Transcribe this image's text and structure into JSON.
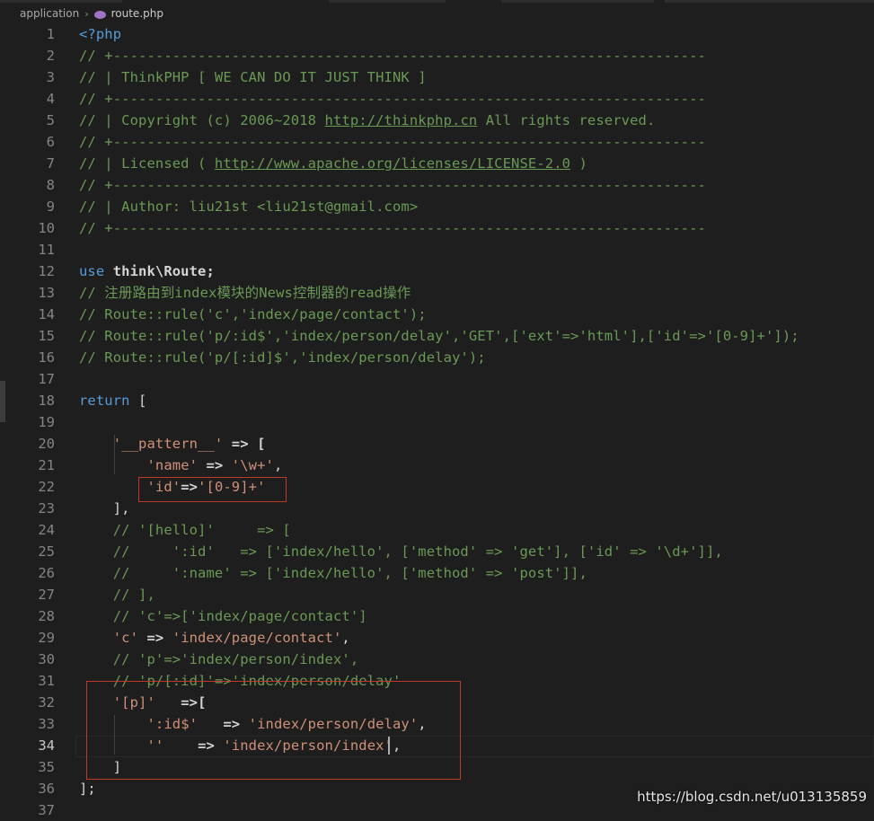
{
  "breadcrumb": {
    "folder": "application",
    "file": "route.php",
    "file_icon": "php-elephant-icon"
  },
  "editor": {
    "active_line": 34,
    "lines": [
      {
        "n": "1",
        "parts": [
          {
            "t": "<?php",
            "c": "kw"
          }
        ]
      },
      {
        "n": "2",
        "parts": [
          {
            "t": "// +----------------------------------------------------------------------",
            "c": "com"
          }
        ]
      },
      {
        "n": "3",
        "parts": [
          {
            "t": "// | ThinkPHP [ WE CAN DO IT JUST THINK ]",
            "c": "com"
          }
        ]
      },
      {
        "n": "4",
        "parts": [
          {
            "t": "// +----------------------------------------------------------------------",
            "c": "com"
          }
        ]
      },
      {
        "n": "5",
        "parts": [
          {
            "t": "// | Copyright (c) 2006~2018 ",
            "c": "com"
          },
          {
            "t": "http://thinkphp.cn",
            "c": "com link"
          },
          {
            "t": " All rights reserved.",
            "c": "com"
          }
        ]
      },
      {
        "n": "6",
        "parts": [
          {
            "t": "// +----------------------------------------------------------------------",
            "c": "com"
          }
        ]
      },
      {
        "n": "7",
        "parts": [
          {
            "t": "// | Licensed ( ",
            "c": "com"
          },
          {
            "t": "http://www.apache.org/licenses/LICENSE-2.0",
            "c": "com link"
          },
          {
            "t": " )",
            "c": "com"
          }
        ]
      },
      {
        "n": "8",
        "parts": [
          {
            "t": "// +----------------------------------------------------------------------",
            "c": "com"
          }
        ]
      },
      {
        "n": "9",
        "parts": [
          {
            "t": "// | Author: liu21st <liu21st@gmail.com>",
            "c": "com"
          }
        ]
      },
      {
        "n": "10",
        "parts": [
          {
            "t": "// +----------------------------------------------------------------------",
            "c": "com"
          }
        ]
      },
      {
        "n": "11",
        "parts": []
      },
      {
        "n": "12",
        "parts": [
          {
            "t": "use",
            "c": "kw"
          },
          {
            "t": " think\\Route;",
            "c": "bold"
          }
        ]
      },
      {
        "n": "13",
        "parts": [
          {
            "t": "// 注册路由到index模块的News控制器的read操作",
            "c": "com"
          }
        ]
      },
      {
        "n": "14",
        "parts": [
          {
            "t": "// Route::rule('c','index/page/contact');",
            "c": "com"
          }
        ]
      },
      {
        "n": "15",
        "parts": [
          {
            "t": "// Route::rule('p/:id$','index/person/delay','GET',['ext'=>'html'],['id'=>'[0-9]+']);",
            "c": "com"
          }
        ]
      },
      {
        "n": "16",
        "parts": [
          {
            "t": "// Route::rule('p/[:id]$','index/person/delay');",
            "c": "com"
          }
        ]
      },
      {
        "n": "17",
        "parts": []
      },
      {
        "n": "18",
        "parts": [
          {
            "t": "return",
            "c": "kw"
          },
          {
            "t": " [",
            "c": "plain"
          }
        ]
      },
      {
        "n": "19",
        "parts": []
      },
      {
        "n": "20",
        "parts": [
          {
            "t": "    ",
            "c": "plain"
          },
          {
            "t": "'__pattern__'",
            "c": "str"
          },
          {
            "t": " => [",
            "c": "bold"
          }
        ]
      },
      {
        "n": "21",
        "parts": [
          {
            "t": "        ",
            "c": "plain"
          },
          {
            "t": "'name'",
            "c": "str"
          },
          {
            "t": " => ",
            "c": "bold"
          },
          {
            "t": "'\\w+'",
            "c": "str"
          },
          {
            "t": ",",
            "c": "plain"
          }
        ]
      },
      {
        "n": "22",
        "parts": [
          {
            "t": "        ",
            "c": "plain"
          },
          {
            "t": "'id'",
            "c": "str"
          },
          {
            "t": "=>",
            "c": "bold"
          },
          {
            "t": "'[0-9]+'",
            "c": "str"
          }
        ]
      },
      {
        "n": "23",
        "parts": [
          {
            "t": "    ],",
            "c": "plain"
          }
        ]
      },
      {
        "n": "24",
        "parts": [
          {
            "t": "    // '[hello]'     => [",
            "c": "com"
          }
        ]
      },
      {
        "n": "25",
        "parts": [
          {
            "t": "    //     ':id'   => ['index/hello', ['method' => 'get'], ['id' => '\\d+']],",
            "c": "com"
          }
        ]
      },
      {
        "n": "26",
        "parts": [
          {
            "t": "    //     ':name' => ['index/hello', ['method' => 'post']],",
            "c": "com"
          }
        ]
      },
      {
        "n": "27",
        "parts": [
          {
            "t": "    // ],",
            "c": "com"
          }
        ]
      },
      {
        "n": "28",
        "parts": [
          {
            "t": "    // 'c'=>['index/page/contact']",
            "c": "com"
          }
        ]
      },
      {
        "n": "29",
        "parts": [
          {
            "t": "    ",
            "c": "plain"
          },
          {
            "t": "'c'",
            "c": "str"
          },
          {
            "t": " => ",
            "c": "bold"
          },
          {
            "t": "'index/page/contact'",
            "c": "str"
          },
          {
            "t": ",",
            "c": "plain"
          }
        ]
      },
      {
        "n": "30",
        "parts": [
          {
            "t": "    // 'p'=>'index/person/index',",
            "c": "com"
          }
        ]
      },
      {
        "n": "31",
        "parts": [
          {
            "t": "    // 'p/[:id]'=>'index/person/delay'",
            "c": "com"
          }
        ]
      },
      {
        "n": "32",
        "parts": [
          {
            "t": "    ",
            "c": "plain"
          },
          {
            "t": "'[p]'",
            "c": "str"
          },
          {
            "t": "   =>[",
            "c": "bold"
          }
        ]
      },
      {
        "n": "33",
        "parts": [
          {
            "t": "        ",
            "c": "plain"
          },
          {
            "t": "':id$'",
            "c": "str"
          },
          {
            "t": "   => ",
            "c": "bold"
          },
          {
            "t": "'index/person/delay'",
            "c": "str"
          },
          {
            "t": ",",
            "c": "plain"
          }
        ]
      },
      {
        "n": "34",
        "parts": [
          {
            "t": "        ",
            "c": "plain"
          },
          {
            "t": "''",
            "c": "str"
          },
          {
            "t": "    => ",
            "c": "bold"
          },
          {
            "t": "'index/person/index'",
            "c": "str"
          },
          {
            "t": ",",
            "c": "plain"
          }
        ]
      },
      {
        "n": "35",
        "parts": [
          {
            "t": "    ]",
            "c": "plain"
          }
        ]
      },
      {
        "n": "36",
        "parts": [
          {
            "t": "];",
            "c": "plain"
          }
        ]
      },
      {
        "n": "37",
        "parts": []
      }
    ]
  },
  "watermark": "https://blog.csdn.net/u013135859"
}
